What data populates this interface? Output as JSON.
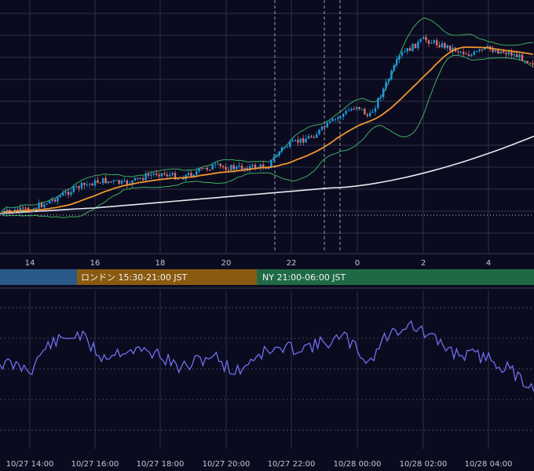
{
  "colors": {
    "background": "#0b0b1f",
    "grid": "#2e3048",
    "candle_up": "#1e9be0",
    "candle_down": "#e0706a",
    "bollinger": "#3fae63",
    "ma_short": "#f0962e",
    "ma_long": "#e8e8ef",
    "oscillator": "#6f6ff0",
    "session_tokyo": "#2a5a8a",
    "session_london": "#8a5a10",
    "session_ny": "#1f6a45"
  },
  "chart_data": [
    {
      "type": "candlestick",
      "title": "",
      "x_ticks": [
        "14",
        "16",
        "18",
        "20",
        "22",
        "0",
        "2",
        "4"
      ],
      "overlays": [
        {
          "indicator": "bollinger-bands",
          "color": "green"
        },
        {
          "indicator": "moving-average-short",
          "color": "orange"
        },
        {
          "indicator": "moving-average-long",
          "color": "white"
        }
      ],
      "sessions": [
        {
          "name": "tokyo",
          "label": ""
        },
        {
          "name": "london",
          "label": "ロンドン 15:30-21:00 JST"
        },
        {
          "name": "ny",
          "label": "NY 21:00-06:00 JST"
        }
      ],
      "grid": true
    },
    {
      "type": "line",
      "title": "",
      "x_ticks": [
        "10/27 14:00",
        "10/27 16:00",
        "10/27 18:00",
        "10/27 20:00",
        "10/27 22:00",
        "10/28 00:00",
        "10/28 02:00",
        "10/28 04:00"
      ],
      "grid": true
    }
  ]
}
